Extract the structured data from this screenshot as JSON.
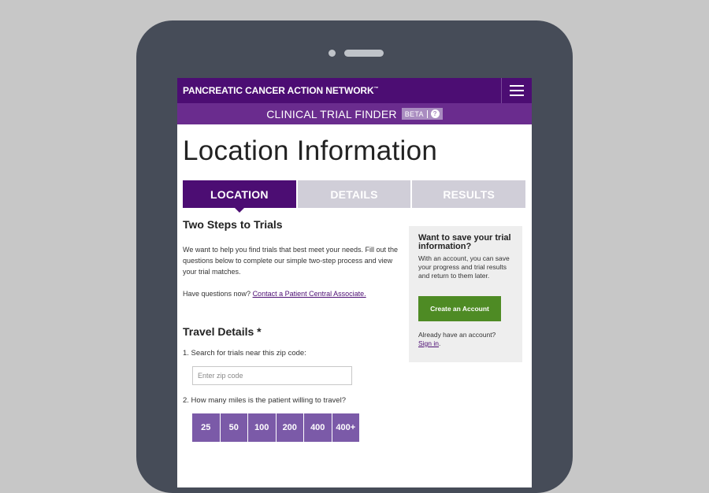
{
  "header": {
    "brand": "PANCREATIC CANCER ACTION NETWORK",
    "brand_mark": "™",
    "subtitle": "CLINICAL TRIAL FINDER",
    "beta_label": "BETA",
    "help_glyph": "?"
  },
  "page": {
    "title": "Location Information"
  },
  "tabs": [
    {
      "label": "LOCATION",
      "active": true
    },
    {
      "label": "DETAILS",
      "active": false
    },
    {
      "label": "RESULTS",
      "active": false
    }
  ],
  "intro": {
    "heading": "Two Steps to Trials",
    "body": "We want to help you find trials that best meet your needs. Fill out the questions below to complete our simple two-step process and view your trial matches.",
    "questions_prefix": "Have questions now? ",
    "questions_link": "Contact a Patient Central Associate."
  },
  "travel": {
    "heading": "Travel Details *",
    "q1": "1. Search for trials near this zip code:",
    "zip_placeholder": "Enter zip code",
    "zip_value": "",
    "q2": "2. How many miles is the patient willing to travel?",
    "miles": [
      "25",
      "50",
      "100",
      "200",
      "400",
      "400+"
    ]
  },
  "account_card": {
    "heading": "Want to save your trial information?",
    "body": "With an account, you can save your progress and trial results and return to them later.",
    "create_button": "Create an Account",
    "already": "Already have an account?",
    "sign_in": "Sign in",
    "sign_in_suffix": "."
  },
  "colors": {
    "brand_purple": "#4c0d73",
    "subbar_purple": "#6a2c8e",
    "mile_purple": "#7b5aa8",
    "green": "#4e8b24",
    "tab_inactive": "#d0ced8"
  },
  "icons": {
    "menu": "hamburger-menu-icon",
    "help": "help-circle-icon"
  }
}
